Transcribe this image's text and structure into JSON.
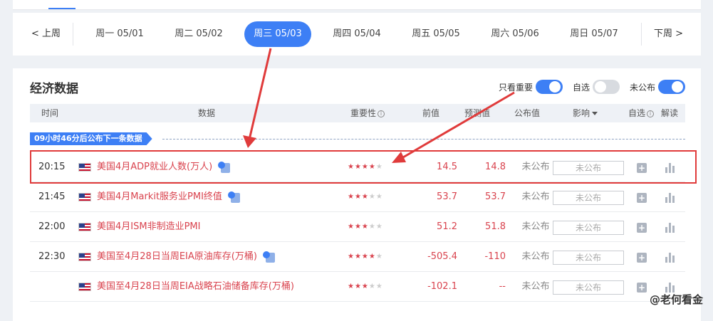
{
  "date_nav": {
    "prev_label": "上周",
    "next_label": "下周",
    "days": [
      {
        "label": "周一 05/01",
        "active": false
      },
      {
        "label": "周二 05/02",
        "active": false
      },
      {
        "label": "周三 05/03",
        "active": true
      },
      {
        "label": "周四 05/04",
        "active": false
      },
      {
        "label": "周五 05/05",
        "active": false
      },
      {
        "label": "周六 05/06",
        "active": false
      },
      {
        "label": "周日 05/07",
        "active": false
      }
    ]
  },
  "panel": {
    "title": "经济数据",
    "toggles": [
      {
        "label": "只看重要",
        "state": "on"
      },
      {
        "label": "自选",
        "state": "off"
      },
      {
        "label": "未公布",
        "state": "on"
      }
    ]
  },
  "table": {
    "headers": {
      "time": "时间",
      "data": "数据",
      "importance": "重要性",
      "previous": "前值",
      "forecast": "预测值",
      "actual": "公布值",
      "impact": "影响",
      "watch": "自选",
      "analysis": "解读"
    },
    "countdown": "09小时46分后公布下一条数据",
    "rows": [
      {
        "time": "20:15",
        "name": "美国4月ADP就业人数(万人)",
        "stars": 4,
        "previous": "14.5",
        "forecast": "14.8",
        "actual": "未公布",
        "impact": "未公布",
        "video": true
      },
      {
        "time": "21:45",
        "name": "美国4月Markit服务业PMI终值",
        "stars": 3,
        "previous": "53.7",
        "forecast": "53.7",
        "actual": "未公布",
        "impact": "未公布",
        "video": true
      },
      {
        "time": "22:00",
        "name": "美国4月ISM非制造业PMI",
        "stars": 3,
        "previous": "51.2",
        "forecast": "51.8",
        "actual": "未公布",
        "impact": "未公布",
        "video": false
      },
      {
        "time": "22:30",
        "name": "美国至4月28日当周EIA原油库存(万桶)",
        "stars": 4,
        "previous": "-505.4",
        "forecast": "-110",
        "actual": "未公布",
        "impact": "未公布",
        "video": true
      },
      {
        "time": "",
        "name": "美国至4月28日当周EIA战略石油储备库存(万桶)",
        "stars": 3,
        "previous": "-102.1",
        "forecast": "--",
        "actual": "未公布",
        "impact": "未公布",
        "video": false
      }
    ]
  },
  "watermark": "@老何看金",
  "colors": {
    "accent": "#3d7ff5",
    "value_red": "#d9434e",
    "highlight_red": "#e03b3b"
  }
}
